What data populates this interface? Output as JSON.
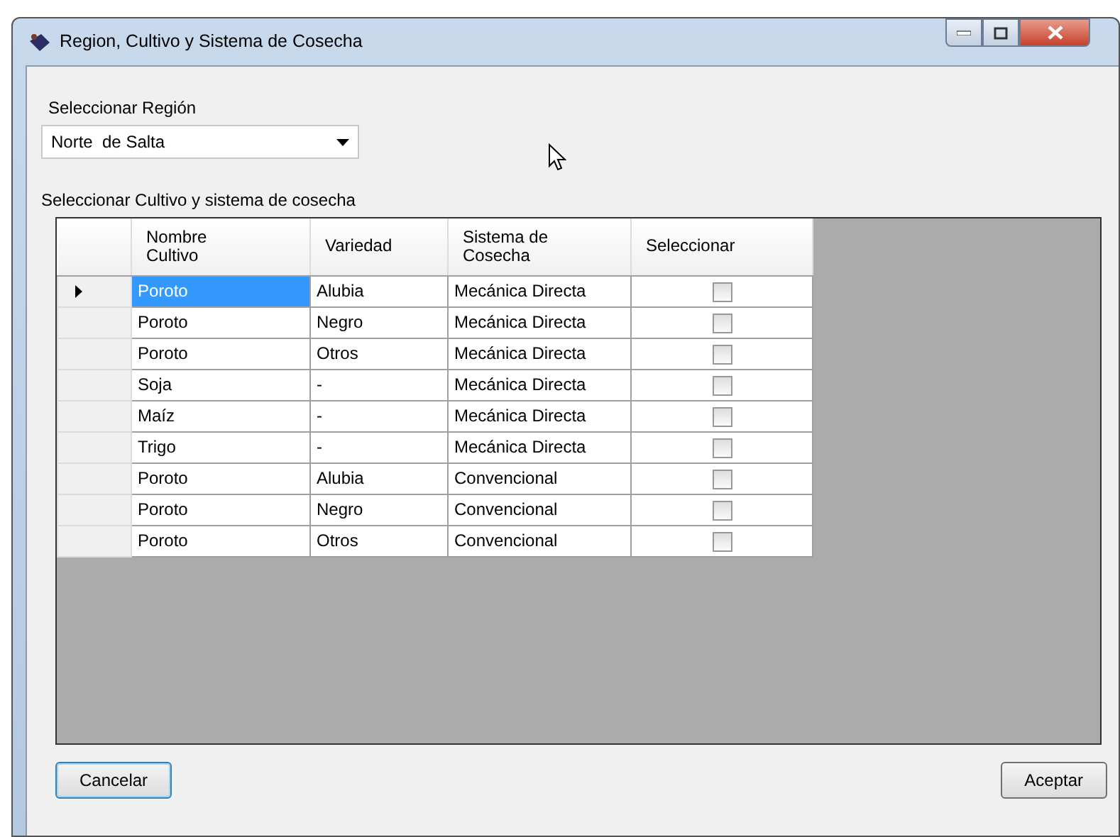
{
  "window": {
    "title": "Region, Cultivo y Sistema de Cosecha"
  },
  "region": {
    "label": "Seleccionar Región",
    "value": "Norte  de Salta"
  },
  "grid": {
    "label": "Seleccionar Cultivo y sistema de cosecha",
    "columns": [
      "Nombre\nCultivo",
      "Variedad",
      "Sistema de\nCosecha",
      "Seleccionar"
    ],
    "rows": [
      {
        "cultivo": "Poroto",
        "variedad": "Alubia",
        "sistema": "Mecánica Directa",
        "checked": false,
        "selected": true
      },
      {
        "cultivo": "Poroto",
        "variedad": "Negro",
        "sistema": "Mecánica Directa",
        "checked": false,
        "selected": false
      },
      {
        "cultivo": "Poroto",
        "variedad": "Otros",
        "sistema": "Mecánica Directa",
        "checked": false,
        "selected": false
      },
      {
        "cultivo": "Soja",
        "variedad": "-",
        "sistema": "Mecánica Directa",
        "checked": false,
        "selected": false
      },
      {
        "cultivo": "Maíz",
        "variedad": "-",
        "sistema": "Mecánica Directa",
        "checked": false,
        "selected": false
      },
      {
        "cultivo": "Trigo",
        "variedad": "-",
        "sistema": "Mecánica Directa",
        "checked": false,
        "selected": false
      },
      {
        "cultivo": "Poroto",
        "variedad": "Alubia",
        "sistema": "Convencional",
        "checked": false,
        "selected": false
      },
      {
        "cultivo": "Poroto",
        "variedad": "Negro",
        "sistema": "Convencional",
        "checked": false,
        "selected": false
      },
      {
        "cultivo": "Poroto",
        "variedad": "Otros",
        "sistema": "Convencional",
        "checked": false,
        "selected": false
      }
    ]
  },
  "buttons": [
    {
      "label": "Cancelar",
      "focused": true
    },
    {
      "label": "Aceptar",
      "focused": false
    }
  ]
}
